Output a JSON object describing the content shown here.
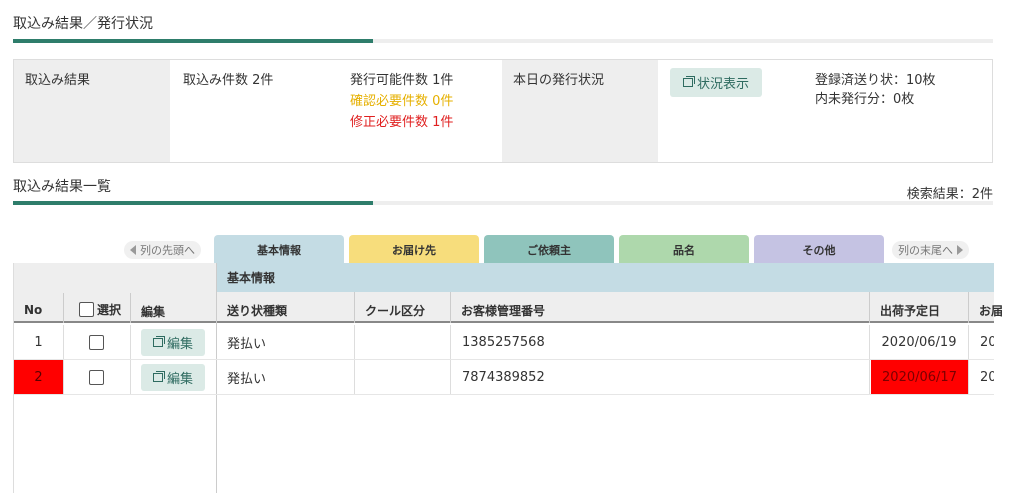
{
  "section1": {
    "title": "取込み結果／発行状況"
  },
  "summary": {
    "import_result_label": "取込み結果",
    "import_count": "取込み件数 2件",
    "issuable_count": "発行可能件数 1件",
    "confirm_needed": "確認必要件数 0件",
    "fix_needed": "修正必要件数 1件",
    "today_status_label": "本日の発行状況",
    "status_button": "状況表示",
    "registered_sent": "登録済送り状：10枚",
    "unissued": "内未発行分：0枚"
  },
  "section2": {
    "title": "取込み結果一覧",
    "result_count": "検索結果：2件"
  },
  "tabs": {
    "prev_label": "列の先頭へ",
    "next_label": "列の末尾へ",
    "items": [
      {
        "label": "基本情報",
        "color": "#c4dce4"
      },
      {
        "label": "お届け先",
        "color": "#f7dd7c"
      },
      {
        "label": "ご依頼主",
        "color": "#8fc4bc"
      },
      {
        "label": "品名",
        "color": "#aed8ac"
      },
      {
        "label": "その他",
        "color": "#c5c3e3"
      }
    ]
  },
  "table": {
    "group_header": "基本情報",
    "columns": {
      "no": "No",
      "select": "選択",
      "edit": "編集",
      "slip_type": "送り状種類",
      "cool": "クール区分",
      "customer_no": "お客様管理番号",
      "ship_date": "出荷予定日",
      "next_partial": "お届"
    },
    "edit_button": "編集",
    "rows": [
      {
        "no": "1",
        "slip_type": "発払い",
        "cool": "",
        "customer_no": "1385257568",
        "ship_date": "2020/06/19",
        "next_partial": "20"
      },
      {
        "no": "2",
        "slip_type": "発払い",
        "cool": "",
        "customer_no": "7874389852",
        "ship_date": "2020/06/17",
        "next_partial": "20"
      }
    ]
  },
  "colors": {
    "accent": "#2e7d6b",
    "error": "#ff0000",
    "warning": "#e6b000"
  }
}
